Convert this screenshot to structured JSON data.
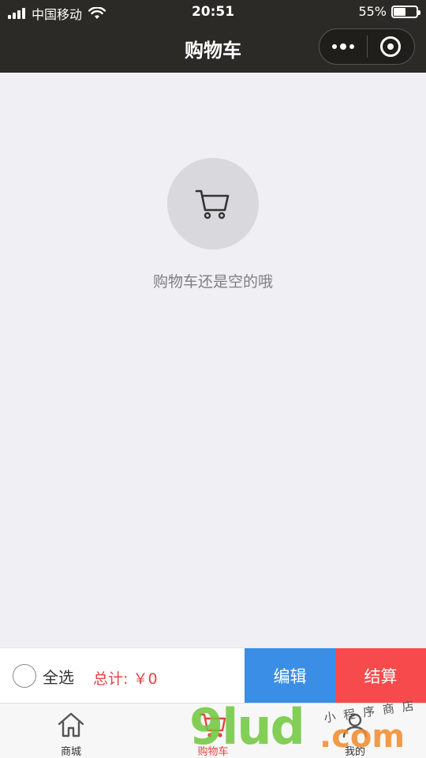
{
  "status_bar": {
    "carrier": "中国移动",
    "time": "20:51",
    "battery_percent_text": "55%",
    "battery_level": 0.55
  },
  "nav": {
    "title": "购物车"
  },
  "empty_state": {
    "icon": "cart-icon",
    "message": "购物车还是空的哦"
  },
  "cart_bar": {
    "select_all_label": "全选",
    "total_text": "总计: ￥0",
    "edit_label": "编辑",
    "checkout_label": "结算"
  },
  "tabbar": {
    "tabs": [
      {
        "label": "商城",
        "icon": "home-icon",
        "active": false
      },
      {
        "label": "购物车",
        "icon": "cart-icon",
        "active": true
      },
      {
        "label": "我的",
        "icon": "user-icon",
        "active": false
      }
    ]
  },
  "watermark": {
    "main": "9lud",
    "suffix": ".com",
    "tagline": "小程序商店"
  },
  "colors": {
    "nav_bg": "#2b2a26",
    "page_bg": "#efeff4",
    "accent_red": "#e64340",
    "edit_blue": "#3a8ee6",
    "checkout_red": "#f64a4d"
  }
}
